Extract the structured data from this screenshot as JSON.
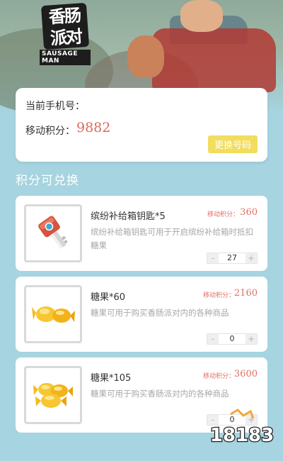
{
  "header": {
    "logo_text": "香肠派对",
    "logo_subtitle": "SAUSAGE MAN"
  },
  "account": {
    "phone_label": "当前手机号：",
    "points_label": "移动积分：",
    "points_value": "9882",
    "change_button": "更换号码"
  },
  "section_title": "积分可兑换",
  "items": [
    {
      "name": "缤纷补给箱钥匙*5",
      "price_label": "移动积分：",
      "price": "360",
      "description": "缤纷补给箱钥匙可用于开启缤纷补给箱时抵扣糖果",
      "quantity": "27",
      "minus": "-",
      "plus": "+",
      "icon": "key-icon"
    },
    {
      "name": "糖果*60",
      "price_label": "移动积分：",
      "price": "2160",
      "description": "糖果可用于购买香肠派对内的各种商品",
      "quantity": "0",
      "minus": "-",
      "plus": "+",
      "icon": "candy-icon"
    },
    {
      "name": "糖果*105",
      "price_label": "移动积分：",
      "price": "3600",
      "description": "糖果可用于购买香肠派对内的各种商品",
      "quantity": "0",
      "minus": "-",
      "plus": "+",
      "icon": "candy-pile-icon"
    }
  ],
  "watermark": "18183",
  "colors": {
    "background": "#a6d4e0",
    "accent_red": "#e07065",
    "button_yellow": "#f2dd5c"
  }
}
